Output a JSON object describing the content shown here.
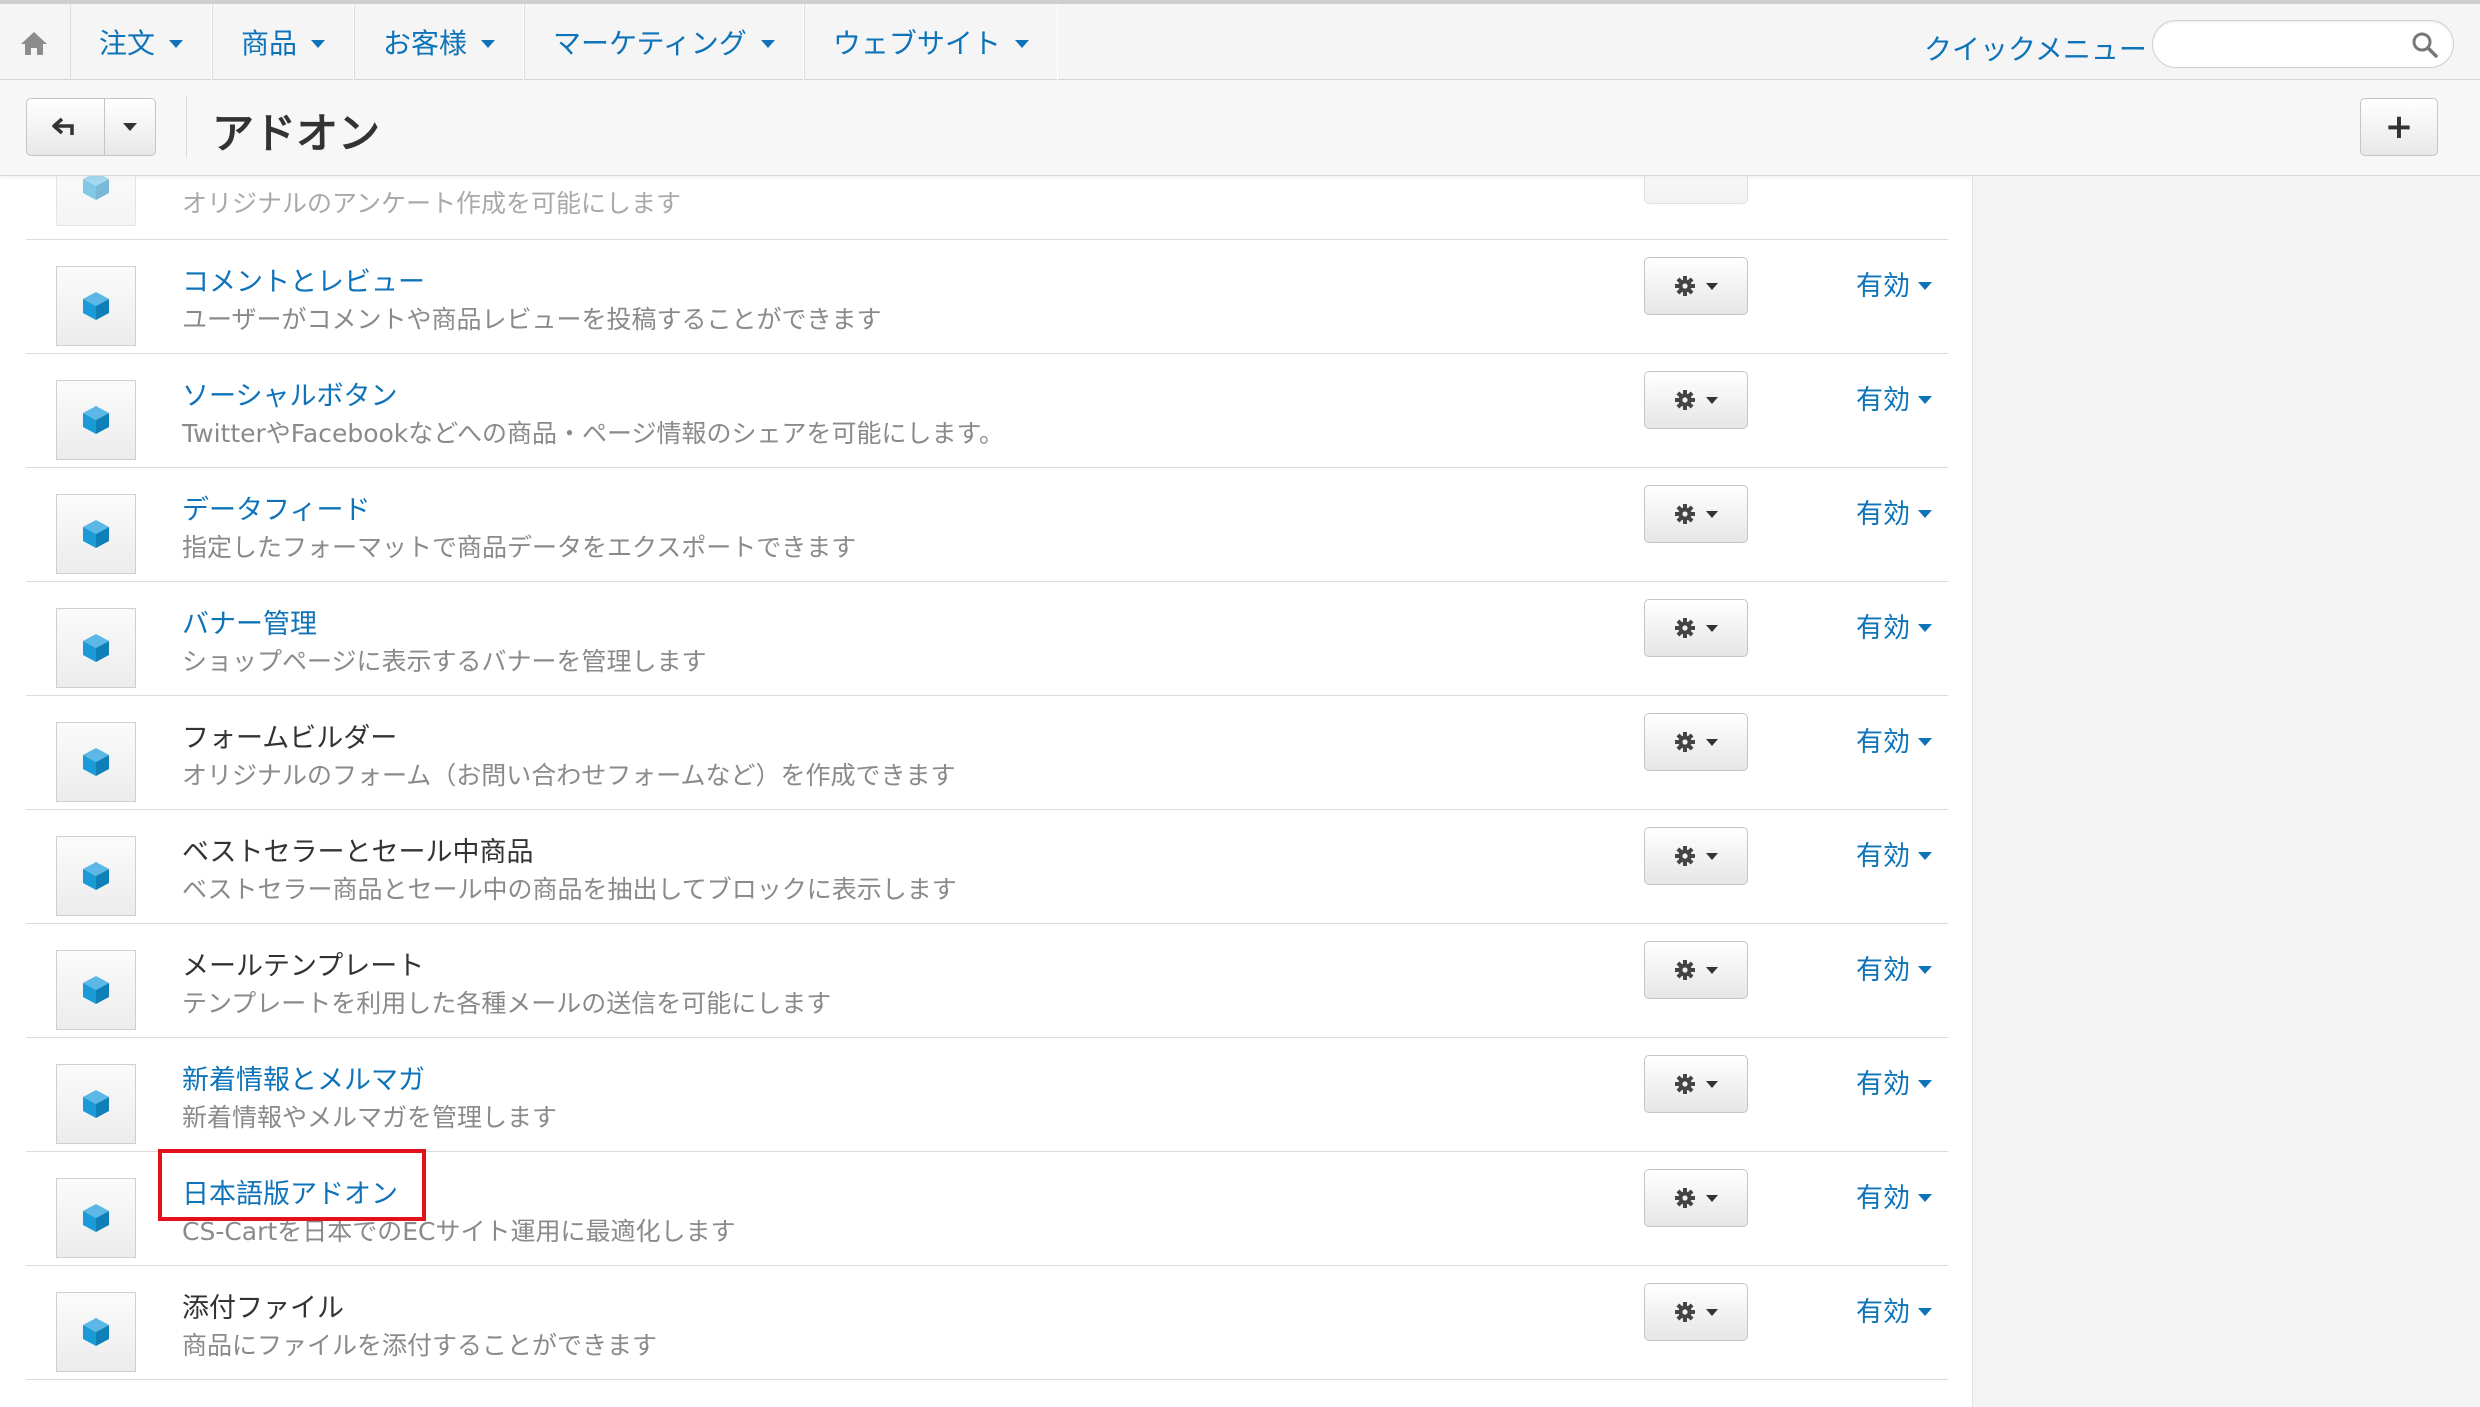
{
  "nav": {
    "items": [
      {
        "label": "注文"
      },
      {
        "label": "商品"
      },
      {
        "label": "お客様"
      },
      {
        "label": "マーケティング"
      },
      {
        "label": "ウェブサイト"
      }
    ],
    "quick_menu": "クイックメニュー",
    "search_placeholder": ""
  },
  "header": {
    "title": "アドオン",
    "add_label": "+"
  },
  "addons_partial": {
    "description": "オリジナルのアンケート作成を可能にします"
  },
  "addons": [
    {
      "name": "コメントとレビュー",
      "description": "ユーザーがコメントや商品レビューを投稿することができます",
      "status": "有効",
      "linked": true
    },
    {
      "name": "ソーシャルボタン",
      "description": "TwitterやFacebookなどへの商品・ページ情報のシェアを可能にします。",
      "status": "有効",
      "linked": true
    },
    {
      "name": "データフィード",
      "description": "指定したフォーマットで商品データをエクスポートできます",
      "status": "有効",
      "linked": true
    },
    {
      "name": "バナー管理",
      "description": "ショップページに表示するバナーを管理します",
      "status": "有効",
      "linked": true
    },
    {
      "name": "フォームビルダー",
      "description": "オリジナルのフォーム（お問い合わせフォームなど）を作成できます",
      "status": "有効",
      "linked": false
    },
    {
      "name": "ベストセラーとセール中商品",
      "description": "ベストセラー商品とセール中の商品を抽出してブロックに表示します",
      "status": "有効",
      "linked": false
    },
    {
      "name": "メールテンプレート",
      "description": "テンプレートを利用した各種メールの送信を可能にします",
      "status": "有効",
      "linked": false
    },
    {
      "name": "新着情報とメルマガ",
      "description": "新着情報やメルマガを管理します",
      "status": "有効",
      "linked": true
    },
    {
      "name": "日本語版アドオン",
      "description": "CS-Cartを日本でのECサイト運用に最適化します",
      "status": "有効",
      "linked": true,
      "highlighted": true
    },
    {
      "name": "添付ファイル",
      "description": "商品にファイルを添付することができます",
      "status": "有効",
      "linked": false
    }
  ],
  "colors": {
    "link": "#0e73b8",
    "highlight": "#e3111b",
    "icon": "#1a9ad6"
  }
}
